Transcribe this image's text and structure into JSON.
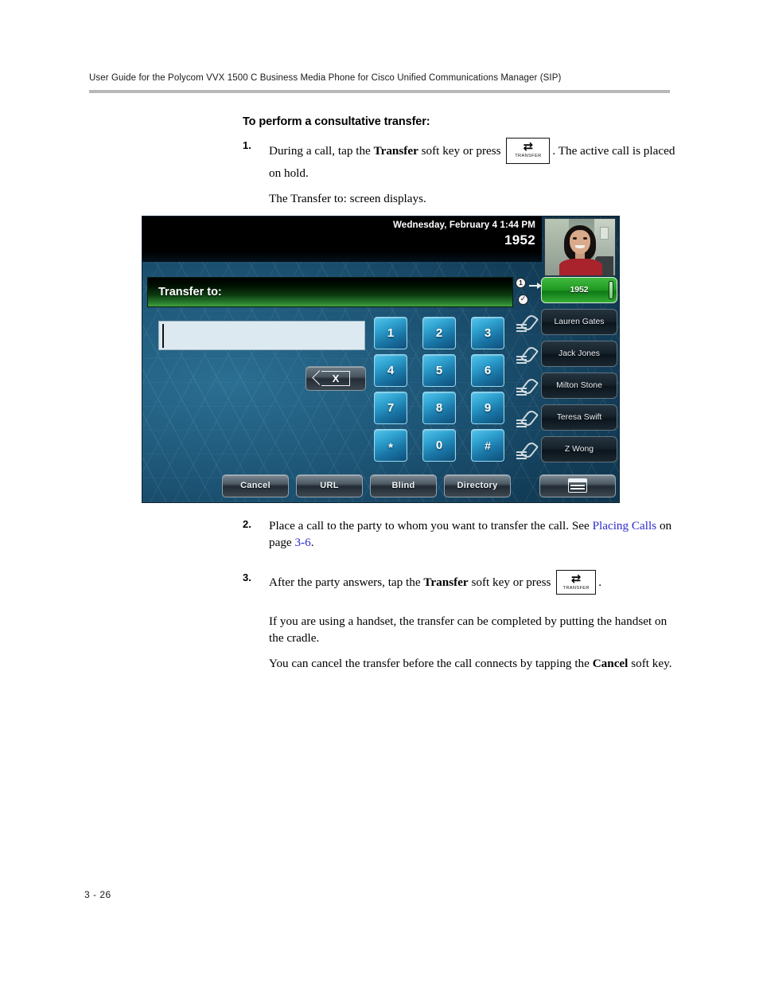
{
  "header": {
    "running_head": "User Guide for the Polycom VVX 1500 C Business Media Phone for Cisco Unified Communications Manager (SIP)"
  },
  "section": {
    "heading": "To perform a consultative transfer:"
  },
  "steps": {
    "step1": {
      "number": "1.",
      "text_before": "During a call, tap the ",
      "bold_term": "Transfer",
      "text_middle": " soft key or press ",
      "text_after": ". The active call is placed on hold.",
      "followup": "The Transfer to: screen displays."
    },
    "step2": {
      "number": "2.",
      "text_before": "Place a call to the party to whom you want to transfer the call. See ",
      "link_text": "Placing Calls",
      "text_middle": " on page ",
      "link_page": "3-6",
      "text_after": "."
    },
    "step3": {
      "number": "3.",
      "text_before": "After the party answers, tap the ",
      "bold_term": "Transfer",
      "text_middle": " soft key or press ",
      "text_after": ".",
      "para1": "If you are using a handset, the transfer can be completed by putting the handset on the cradle.",
      "para2_before": "You can cancel the transfer before the call connects by tapping the ",
      "para2_bold": "Cancel",
      "para2_after": " soft key."
    }
  },
  "hardkey": {
    "arrows_glyph": "⇄",
    "label": "TRANSFER"
  },
  "phone_screen": {
    "status": {
      "datetime": "Wednesday, February 4  1:44 PM",
      "extension": "1952"
    },
    "banner": {
      "label": "Transfer to:"
    },
    "dial_entry": {
      "value": "",
      "placeholder": ""
    },
    "backspace": {
      "label": "X"
    },
    "dialpad_keys": [
      "1",
      "2",
      "3",
      "4",
      "5",
      "6",
      "7",
      "8",
      "9",
      "*",
      "0",
      "#"
    ],
    "line_keys": [
      {
        "label": "1952",
        "state": "active",
        "badge": "1",
        "check": "✓"
      },
      {
        "label": "Lauren Gates",
        "state": "idle"
      },
      {
        "label": "Jack Jones",
        "state": "idle"
      },
      {
        "label": "Milton Stone",
        "state": "idle"
      },
      {
        "label": "Teresa Swift",
        "state": "idle"
      },
      {
        "label": "Z Wong",
        "state": "idle"
      }
    ],
    "softkeys": [
      {
        "label": "Cancel",
        "icon": ""
      },
      {
        "label": "URL",
        "icon": ""
      },
      {
        "label": "Blind",
        "icon": ""
      },
      {
        "label": "Directory",
        "icon": ""
      }
    ],
    "menu_softkey": {
      "icon": "window-list-icon"
    }
  },
  "footer": {
    "page_number": "3 - 26"
  },
  "colors": {
    "link": "#2b2bc9",
    "active_line_green": "#2f9e2f",
    "dial_key_blue": "#30a4d2",
    "header_rule": "#b8b8b8"
  }
}
